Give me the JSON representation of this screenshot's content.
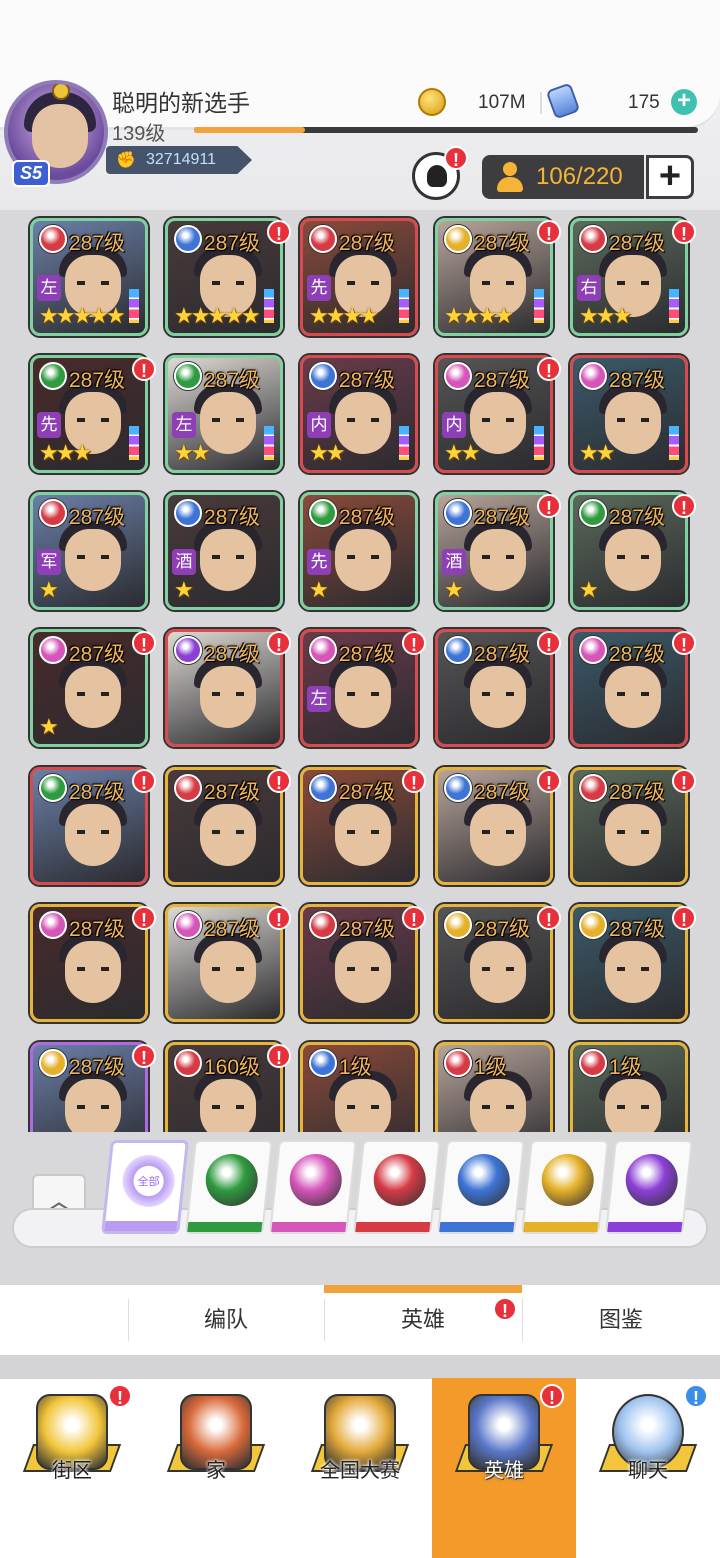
{
  "player": {
    "name": "聪明的新选手",
    "level": "139级",
    "vip": "S5",
    "power": "32714911",
    "exp_fraction": 0.22
  },
  "currency": {
    "coins": "107M",
    "gems": "175"
  },
  "hero_count": "106/220",
  "heroes": [
    {
      "level": "287级",
      "faction": "red",
      "tag": "左",
      "stars": 5,
      "alert": false,
      "frame": "green",
      "crown": true
    },
    {
      "level": "287级",
      "faction": "blue",
      "tag": "",
      "stars": 5,
      "alert": true,
      "frame": "green",
      "crown": true
    },
    {
      "level": "287级",
      "faction": "red",
      "tag": "先",
      "stars": 4,
      "alert": false,
      "frame": "red",
      "crown": true
    },
    {
      "level": "287级",
      "faction": "yellow",
      "tag": "",
      "stars": 4,
      "alert": true,
      "frame": "green",
      "crown": false
    },
    {
      "level": "287级",
      "faction": "red",
      "tag": "右",
      "stars": 3,
      "alert": true,
      "frame": "green",
      "crown": true
    },
    {
      "level": "287级",
      "faction": "green",
      "tag": "先",
      "stars": 3,
      "alert": true,
      "frame": "green",
      "crown": true
    },
    {
      "level": "287级",
      "faction": "green",
      "tag": "左",
      "stars": 2,
      "alert": false,
      "frame": "green",
      "crown": true
    },
    {
      "level": "287级",
      "faction": "blue",
      "tag": "内",
      "stars": 2,
      "alert": false,
      "frame": "red",
      "crown": true
    },
    {
      "level": "287级",
      "faction": "pink",
      "tag": "内",
      "stars": 2,
      "alert": true,
      "frame": "red",
      "crown": true
    },
    {
      "level": "287级",
      "faction": "pink",
      "tag": "",
      "stars": 2,
      "alert": false,
      "frame": "red",
      "crown": false
    },
    {
      "level": "287级",
      "faction": "red",
      "tag": "军",
      "stars": 1,
      "alert": false,
      "frame": "green",
      "crown": true
    },
    {
      "level": "287级",
      "faction": "blue",
      "tag": "酒",
      "stars": 1,
      "alert": false,
      "frame": "green",
      "crown": true
    },
    {
      "level": "287级",
      "faction": "green",
      "tag": "先",
      "stars": 1,
      "alert": false,
      "frame": "green",
      "crown": true
    },
    {
      "level": "287级",
      "faction": "blue",
      "tag": "酒",
      "stars": 1,
      "alert": true,
      "frame": "green",
      "crown": true
    },
    {
      "level": "287级",
      "faction": "green",
      "tag": "",
      "stars": 1,
      "alert": true,
      "frame": "green",
      "crown": true
    },
    {
      "level": "287级",
      "faction": "pink",
      "tag": "",
      "stars": 1,
      "alert": true,
      "frame": "green",
      "crown": false
    },
    {
      "level": "287级",
      "faction": "purple",
      "tag": "",
      "stars": 0,
      "alert": true,
      "frame": "red",
      "crown": true
    },
    {
      "level": "287级",
      "faction": "pink",
      "tag": "左",
      "stars": 0,
      "alert": true,
      "frame": "red",
      "crown": false
    },
    {
      "level": "287级",
      "faction": "blue",
      "tag": "",
      "stars": 0,
      "alert": true,
      "frame": "red",
      "crown": true
    },
    {
      "level": "287级",
      "faction": "pink",
      "tag": "",
      "stars": 0,
      "alert": true,
      "frame": "red",
      "crown": false
    },
    {
      "level": "287级",
      "faction": "green",
      "tag": "",
      "stars": 0,
      "alert": true,
      "frame": "red",
      "crown": false
    },
    {
      "level": "287级",
      "faction": "red",
      "tag": "",
      "stars": 0,
      "alert": true,
      "frame": "gold",
      "crown": false
    },
    {
      "level": "287级",
      "faction": "blue",
      "tag": "",
      "stars": 0,
      "alert": true,
      "frame": "gold",
      "crown": false
    },
    {
      "level": "287级",
      "faction": "blue",
      "tag": "",
      "stars": 0,
      "alert": true,
      "frame": "gold",
      "crown": false
    },
    {
      "level": "287级",
      "faction": "red",
      "tag": "",
      "stars": 0,
      "alert": true,
      "frame": "gold",
      "crown": false
    },
    {
      "level": "287级",
      "faction": "pink",
      "tag": "",
      "stars": 0,
      "alert": true,
      "frame": "gold",
      "crown": false
    },
    {
      "level": "287级",
      "faction": "pink",
      "tag": "",
      "stars": 0,
      "alert": true,
      "frame": "gold",
      "crown": false
    },
    {
      "level": "287级",
      "faction": "red",
      "tag": "",
      "stars": 0,
      "alert": true,
      "frame": "gold",
      "crown": false
    },
    {
      "level": "287级",
      "faction": "yellow",
      "tag": "",
      "stars": 0,
      "alert": true,
      "frame": "gold",
      "crown": false
    },
    {
      "level": "287级",
      "faction": "yellow",
      "tag": "",
      "stars": 0,
      "alert": true,
      "frame": "gold",
      "crown": false
    },
    {
      "level": "287级",
      "faction": "yellow",
      "tag": "",
      "stars": 0,
      "alert": true,
      "frame": "purple",
      "crown": false
    },
    {
      "level": "160级",
      "faction": "red",
      "tag": "",
      "stars": 0,
      "alert": true,
      "frame": "gold",
      "crown": false
    },
    {
      "level": "1级",
      "faction": "blue",
      "tag": "",
      "stars": 0,
      "alert": false,
      "frame": "gold",
      "crown": false
    },
    {
      "level": "1级",
      "faction": "red",
      "tag": "",
      "stars": 0,
      "alert": false,
      "frame": "gold",
      "crown": false
    },
    {
      "level": "1级",
      "faction": "red",
      "tag": "",
      "stars": 0,
      "alert": false,
      "frame": "gold",
      "crown": false
    }
  ],
  "filters": [
    {
      "id": "all",
      "label": "全部",
      "color": "#b99cf1"
    },
    {
      "id": "green",
      "label": "",
      "color": "#2e9b3f"
    },
    {
      "id": "pink",
      "label": "",
      "color": "#d655b9"
    },
    {
      "id": "red",
      "label": "",
      "color": "#d63a45"
    },
    {
      "id": "blue",
      "label": "",
      "color": "#3d74d6"
    },
    {
      "id": "yellow",
      "label": "",
      "color": "#e5b12a"
    },
    {
      "id": "purple",
      "label": "",
      "color": "#8b3fd6"
    }
  ],
  "subtabs": [
    "编队",
    "英雄",
    "图鉴"
  ],
  "nav": [
    {
      "label": "街区",
      "icon": "signpost-icon",
      "alert": "!",
      "alert_color": "#e8303b"
    },
    {
      "label": "家",
      "icon": "house-icon",
      "alert": "",
      "alert_color": ""
    },
    {
      "label": "全国大赛",
      "icon": "trophy-icon",
      "alert": "",
      "alert_color": ""
    },
    {
      "label": "英雄",
      "icon": "cards-icon",
      "alert": "!",
      "alert_color": "#e8303b"
    },
    {
      "label": "聊天",
      "icon": "chat-bubble-icon",
      "alert": "!",
      "alert_color": "#3a8ee8"
    }
  ],
  "colors": {
    "accent_orange": "#f1a33b",
    "alert_red": "#e8303b",
    "gold_text": "#f2b55a",
    "faction": {
      "red": "#d63a45",
      "blue": "#3d74d6",
      "green": "#2e9b3f",
      "pink": "#d655b9",
      "yellow": "#e5b12a",
      "purple": "#8b3fd6"
    },
    "frame": {
      "green": "#7fd1a0",
      "red": "#d94a4f",
      "gold": "#e6b43a",
      "purple": "#b06ae0"
    }
  }
}
